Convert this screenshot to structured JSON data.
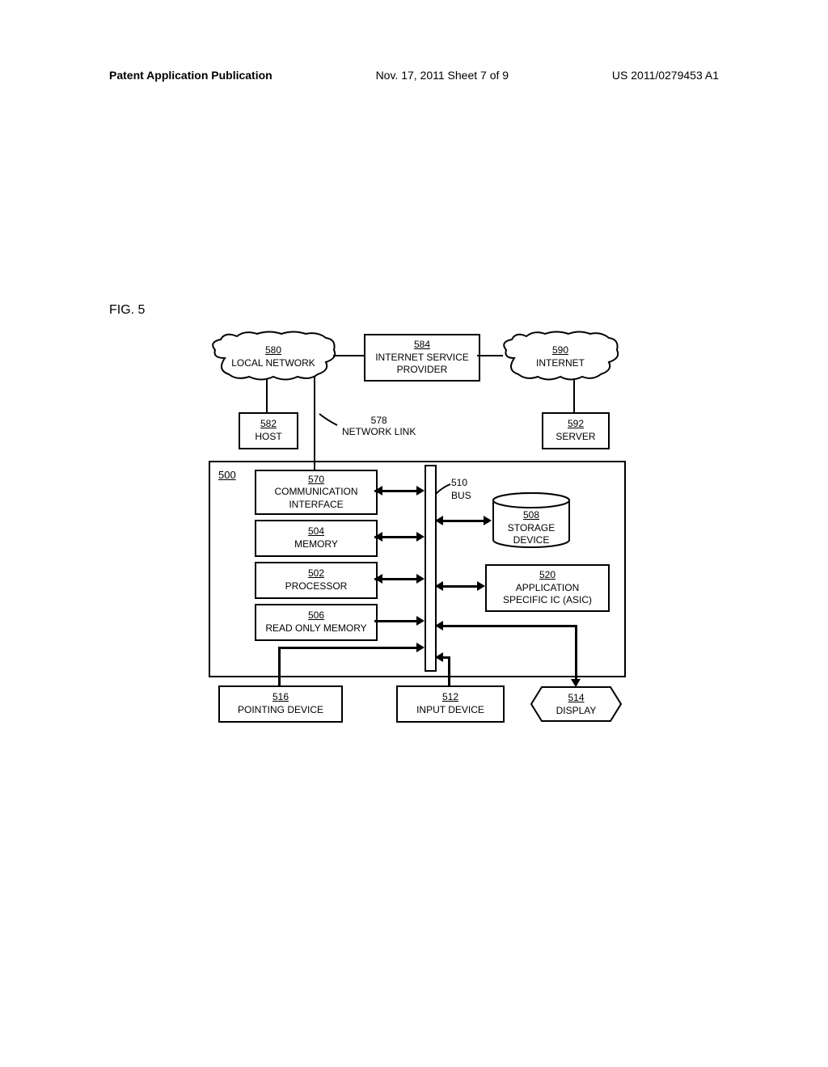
{
  "header": {
    "left": "Patent Application Publication",
    "center": "Nov. 17, 2011  Sheet 7 of 9",
    "right": "US 2011/0279453 A1"
  },
  "figure_label": "FIG. 5",
  "components": {
    "local_network": {
      "ref": "580",
      "label": "LOCAL NETWORK"
    },
    "isp": {
      "ref": "584",
      "label1": "INTERNET SERVICE",
      "label2": "PROVIDER"
    },
    "internet": {
      "ref": "590",
      "label": "INTERNET"
    },
    "host": {
      "ref": "582",
      "label": "HOST"
    },
    "network_link": {
      "ref": "578",
      "label": "NETWORK LINK"
    },
    "server": {
      "ref": "592",
      "label": "SERVER"
    },
    "main": {
      "ref": "500"
    },
    "comm_interface": {
      "ref": "570",
      "label1": "COMMUNICATION",
      "label2": "INTERFACE"
    },
    "bus": {
      "ref": "510",
      "label": "BUS"
    },
    "storage": {
      "ref": "508",
      "label1": "STORAGE",
      "label2": "DEVICE"
    },
    "memory": {
      "ref": "504",
      "label": "MEMORY"
    },
    "processor": {
      "ref": "502",
      "label": "PROCESSOR"
    },
    "asic": {
      "ref": "520",
      "label1": "APPLICATION",
      "label2": "SPECIFIC IC (ASIC)"
    },
    "rom": {
      "ref": "506",
      "label": "READ ONLY MEMORY"
    },
    "pointing": {
      "ref": "516",
      "label": "POINTING DEVICE"
    },
    "input": {
      "ref": "512",
      "label": "INPUT DEVICE"
    },
    "display": {
      "ref": "514",
      "label": "DISPLAY"
    }
  }
}
